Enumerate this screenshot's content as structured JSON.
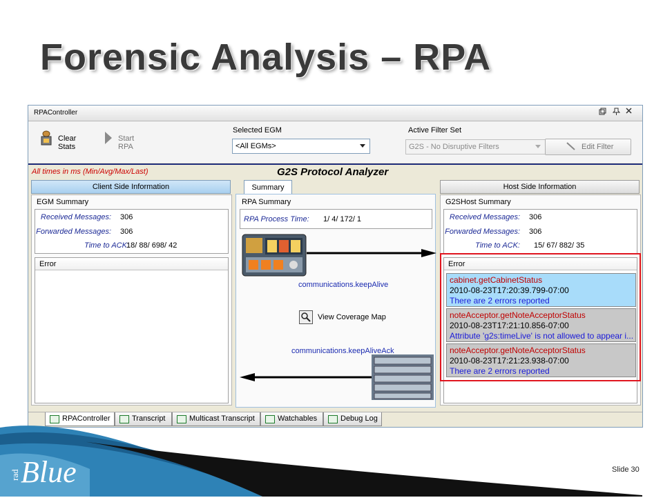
{
  "slide": {
    "title": "Forensic Analysis – RPA",
    "number_label": "Slide 30",
    "logo_text": {
      "small": "rad",
      "big": "Blue"
    }
  },
  "window": {
    "title": "RPAController",
    "controls": [
      "restore-icon",
      "pin-icon",
      "close-icon"
    ]
  },
  "toolbar": {
    "clear_stats": "Clear Stats",
    "start_rpa": "Start RPA",
    "selected_egm_label": "Selected EGM",
    "selected_egm_value": "<All EGMs>",
    "active_filter_label": "Active Filter Set",
    "active_filter_value": "G2S - No Disruptive Filters",
    "edit_filter": "Edit Filter"
  },
  "analyzer": {
    "times_note": "All times in ms (Min/Avg/Max/Last)",
    "title": "G2S Protocol Analyzer",
    "client_header": "Client Side Information",
    "summary_tab": "Summary",
    "host_header": "Host Side Information"
  },
  "egm_summary": {
    "title": "EGM Summary",
    "received_label": "Received Messages:",
    "received_value": "306",
    "forwarded_label": "Forwarded Messages:",
    "forwarded_value": "306",
    "ack_label": "Time to ACK:",
    "ack_value": "18/  88/  698/  42",
    "error_header": "Error"
  },
  "rpa_summary": {
    "title": "RPA Summary",
    "process_label": "RPA Process Time:",
    "process_value": "1/   4/  172/   1",
    "keep_alive": "communications.keepAlive",
    "coverage_map": "View Coverage Map",
    "keep_alive_ack": "communications.keepAliveAck"
  },
  "host_summary": {
    "title": "G2SHost Summary",
    "received_label": "Received Messages:",
    "received_value": "306",
    "forwarded_label": "Forwarded Messages:",
    "forwarded_value": "306",
    "ack_label": "Time to ACK:",
    "ack_value": "15/  67/  882/  35",
    "error_header": "Error",
    "errors": [
      {
        "method": "cabinet.getCabinetStatus",
        "time": "2010-08-23T17:20:39.799-07:00",
        "message": "There are 2 errors reported"
      },
      {
        "method": "noteAcceptor.getNoteAcceptorStatus",
        "time": "2010-08-23T17:21:10.856-07:00",
        "message": "Attribute 'g2s:timeLive' is not allowed to appear i..."
      },
      {
        "method": "noteAcceptor.getNoteAcceptorStatus",
        "time": "2010-08-23T17:21:23.938-07:00",
        "message": "There are 2 errors reported"
      }
    ]
  },
  "bottom_tabs": [
    "RPAController",
    "Transcript",
    "Multicast Transcript",
    "Watchables",
    "Debug Log"
  ],
  "colors": {
    "highlight_outline": "#e0141e",
    "selected_error_bg": "#a8dcfa",
    "error_method": "#c00000",
    "error_message": "#1a1ad8",
    "label_blue": "#1c2a96"
  }
}
